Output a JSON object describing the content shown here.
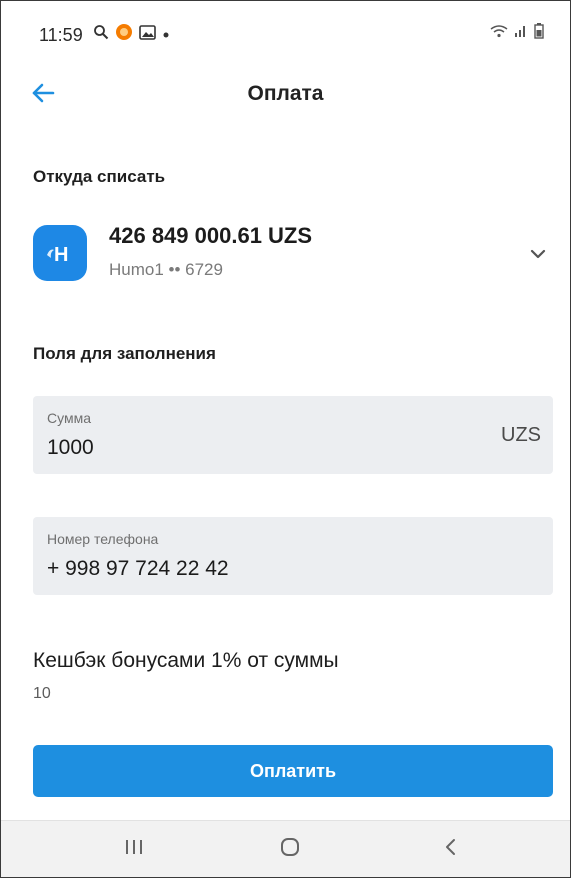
{
  "status_bar": {
    "time": "11:59",
    "icons": [
      "search-icon",
      "app-notification-icon",
      "gallery-icon",
      "dot-icon"
    ],
    "right_icons": [
      "wifi-icon",
      "signal-icon",
      "battery-icon"
    ]
  },
  "header": {
    "title": "Оплата",
    "back_icon": "arrow-left-icon"
  },
  "source": {
    "label": "Откуда списать",
    "account": {
      "logo_letter": "H",
      "amount": "426 849 000.61 UZS",
      "card": "Humo1  •• 6729"
    }
  },
  "fields_section": {
    "label": "Поля для заполнения",
    "amount": {
      "label": "Сумма",
      "value": "1000",
      "currency": "UZS"
    },
    "phone": {
      "label": "Номер телефона",
      "value": "+ 998 97 724 22 42"
    }
  },
  "cashback": {
    "title": "Кешбэк бонусами 1% от суммы",
    "value": "10"
  },
  "pay_button": {
    "label": "Оплатить"
  },
  "colors": {
    "accent": "#1e8fe0",
    "field_bg": "#eceef1",
    "logo_bg": "#1e88e5"
  }
}
